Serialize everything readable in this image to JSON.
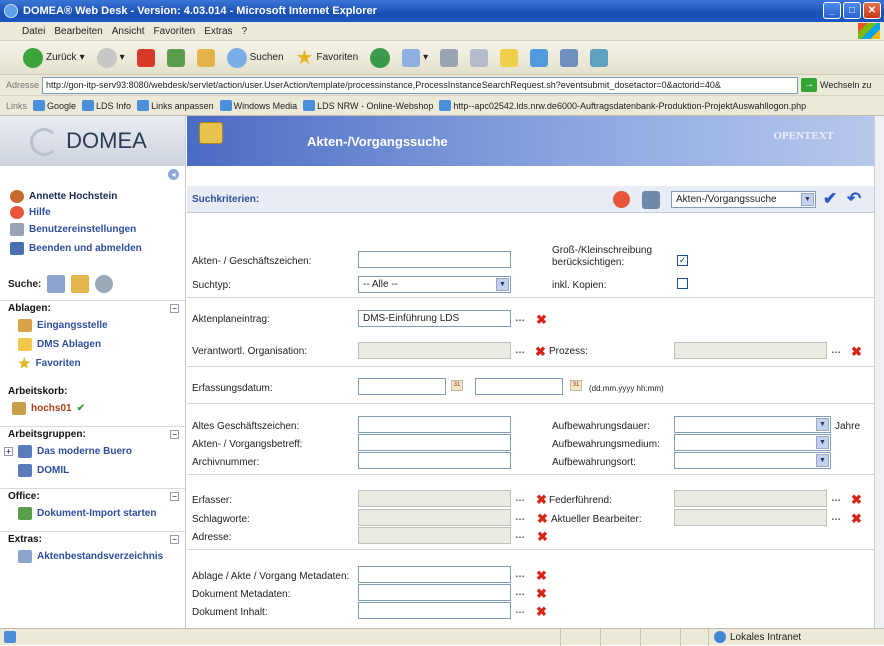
{
  "window": {
    "title": "DOMEA® Web Desk - Version: 4.03.014 - Microsoft Internet Explorer"
  },
  "menubar": [
    "Datei",
    "Bearbeiten",
    "Ansicht",
    "Favoriten",
    "Extras",
    "?"
  ],
  "toolbar": {
    "back": "Zurück",
    "search": "Suchen",
    "favorites": "Favoriten"
  },
  "address": {
    "label": "Adresse",
    "url": "http://gon-itp-serv93:8080/webdesk/servlet/action/user.UserAction/template/processinstance,ProcessInstanceSearchRequest.sh?eventsubmit_dosetactor=0&actorid=40&",
    "go": "Wechseln zu"
  },
  "links": {
    "label": "Links",
    "items": [
      "Google",
      "LDS Info",
      "Links anpassen",
      "Windows Media",
      "LDS NRW - Online-Webshop",
      "http--apc02542.lds.nrw.de6000-Auftragsdatenbank-Produktion-ProjektAuswahllogon.php"
    ]
  },
  "sidebar": {
    "logo": "DOMEA",
    "user": "Annette Hochstein",
    "links": [
      "Hilfe",
      "Benutzereinstellungen",
      "Beenden und abmelden"
    ],
    "search_label": "Suche:",
    "ablagen": {
      "title": "Ablagen:",
      "items": [
        "Eingangsstelle",
        "DMS Ablagen",
        "Favoriten"
      ]
    },
    "arbeitskorb": {
      "title": "Arbeitskorb:",
      "items": [
        "hochs01"
      ]
    },
    "arbeitsgruppen": {
      "title": "Arbeitsgruppen:",
      "items": [
        "Das moderne Buero",
        "DOMIL"
      ]
    },
    "office": {
      "title": "Office:",
      "items": [
        "Dokument-Import starten"
      ]
    },
    "extras": {
      "title": "Extras:",
      "items": [
        "Aktenbestandsverzeichnis"
      ]
    }
  },
  "banner": {
    "title": "Akten-/Vorgangssuche",
    "brand": "OPENTEXT"
  },
  "criteria": {
    "title": "Suchkriterien:",
    "search_select": "Akten-/Vorgangssuche"
  },
  "form": {
    "aktenzeichen": "Akten- / Geschäftszeichen:",
    "grossklein": "Groß-/Kleinschreibung berücksichtigen:",
    "suchtyp": "Suchtyp:",
    "suchtyp_value": "-- Alle --",
    "kopien": "inkl. Kopien:",
    "aktenplan": "Aktenplaneintrag:",
    "aktenplan_value": "DMS-Einführung LDS",
    "organisation": "Verantwortl. Organisation:",
    "prozess": "Prozess:",
    "erfassungsdatum": "Erfassungsdatum:",
    "date_hint": "(dd.mm.yyyy hh:mm)",
    "altes": "Altes Geschäftszeichen:",
    "betreff": "Akten- / Vorgangsbetreff:",
    "archivnummer": "Archivnummer:",
    "dauer": "Aufbewahrungsdauer:",
    "jahre": "Jahre",
    "medium": "Aufbewahrungsmedium:",
    "ort": "Aufbewahrungsort:",
    "erfasser": "Erfasser:",
    "federfuehrend": "Federführend:",
    "schlagworte": "Schlagworte:",
    "bearbeiter": "Aktueller Bearbeiter:",
    "adresse": "Adresse:",
    "meta_ablage": "Ablage / Akte / Vorgang Metadaten:",
    "meta_dok": "Dokument Metadaten:",
    "dok_inhalt": "Dokument Inhalt:"
  },
  "status": {
    "zone": "Lokales Intranet"
  }
}
